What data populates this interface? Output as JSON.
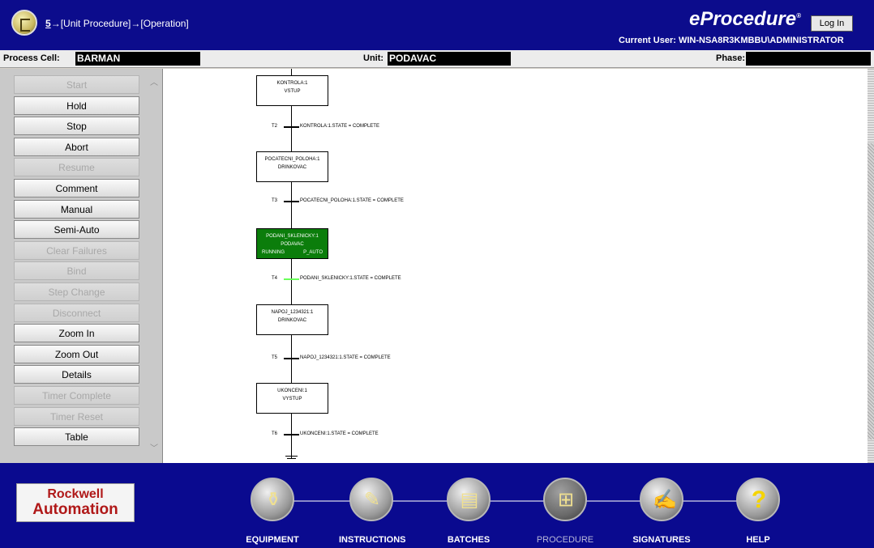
{
  "header": {
    "breadcrumb_num": "5",
    "breadcrumb_arrow1": "→",
    "breadcrumb_text": "[Unit Procedure]→[Operation]",
    "brand": "eProcedure",
    "brand_mark": "®",
    "login_label": "Log In",
    "current_user": "Current User: WIN-NSA8R3KMBBU\\ADMINISTRATOR"
  },
  "context": {
    "process_cell_label": "Process Cell:",
    "process_cell_value": "BARMAN",
    "unit_label": "Unit:",
    "unit_value": "PODAVAC",
    "phase_label": "Phase:",
    "phase_value": ""
  },
  "commands": [
    {
      "label": "Start",
      "enabled": false
    },
    {
      "label": "Hold",
      "enabled": true
    },
    {
      "label": "Stop",
      "enabled": true
    },
    {
      "label": "Abort",
      "enabled": true
    },
    {
      "label": "Resume",
      "enabled": false
    },
    {
      "label": "Comment",
      "enabled": true
    },
    {
      "label": "Manual",
      "enabled": true
    },
    {
      "label": "Semi-Auto",
      "enabled": true
    },
    {
      "label": "Clear Failures",
      "enabled": false
    },
    {
      "label": "Bind",
      "enabled": false
    },
    {
      "label": "Step Change",
      "enabled": false
    },
    {
      "label": "Disconnect",
      "enabled": false
    },
    {
      "label": "Zoom In",
      "enabled": true
    },
    {
      "label": "Zoom Out",
      "enabled": true
    },
    {
      "label": "Details",
      "enabled": true
    },
    {
      "label": "Timer Complete",
      "enabled": false
    },
    {
      "label": "Timer Reset",
      "enabled": false
    },
    {
      "label": "Table",
      "enabled": true
    }
  ],
  "sfc": {
    "steps": [
      {
        "name": "KONTROLA:1",
        "unit": "VSTUP",
        "active": false
      },
      {
        "name": "POCATECNI_POLOHA:1",
        "unit": "DRINKOVAC",
        "active": false
      },
      {
        "name": "PODANI_SKLENICKY:1",
        "unit": "PODAVAC",
        "active": true,
        "state": "RUNNING",
        "mode": "P_AUTO"
      },
      {
        "name": "NAPOJ_1234321:1",
        "unit": "DRINKOVAC",
        "active": false
      },
      {
        "name": "UKONCENI:1",
        "unit": "VYSTUP",
        "active": false
      }
    ],
    "transitions": [
      {
        "name": "T2",
        "condition": "KONTROLA:1.STATE = COMPLETE",
        "active": false
      },
      {
        "name": "T3",
        "condition": "POCATECNI_POLOHA:1.STATE = COMPLETE",
        "active": false
      },
      {
        "name": "T4",
        "condition": "PODANI_SKLENICKY:1.STATE = COMPLETE",
        "active": true
      },
      {
        "name": "T5",
        "condition": "NAPOJ_1234321:1.STATE = COMPLETE",
        "active": false
      },
      {
        "name": "T6",
        "condition": "UKONCENI:1.STATE = COMPLETE",
        "active": false
      }
    ]
  },
  "footer": {
    "logo_line1": "Rockwell",
    "logo_line2": "Automation",
    "nav": [
      {
        "label": "EQUIPMENT",
        "icon": "equipment-icon",
        "glyph": "⚱",
        "active": true
      },
      {
        "label": "INSTRUCTIONS",
        "icon": "instructions-icon",
        "glyph": "✎",
        "active": true
      },
      {
        "label": "BATCHES",
        "icon": "batches-icon",
        "glyph": "▤",
        "active": true
      },
      {
        "label": "PROCEDURE",
        "icon": "procedure-icon",
        "glyph": "⊞",
        "active": false
      },
      {
        "label": "SIGNATURES",
        "icon": "signatures-icon",
        "glyph": "✍",
        "active": true
      },
      {
        "label": "HELP",
        "icon": "help-icon",
        "glyph": "?",
        "active": true
      }
    ]
  },
  "colors": {
    "header_bg": "#0c0c8c",
    "footer_bg": "#0a0a8f",
    "active_step": "#0b7d0b",
    "active_transition": "#6aff5a",
    "help_glyph": "#f5d400"
  }
}
